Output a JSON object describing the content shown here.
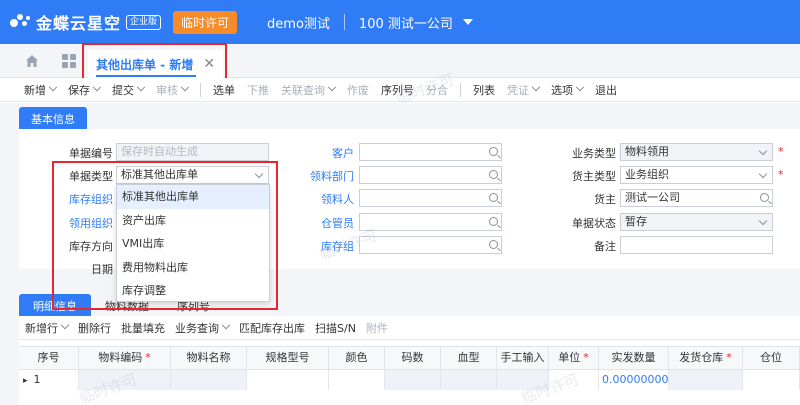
{
  "header": {
    "logo_text": "金蝶云星空",
    "edition_badge": "企业版",
    "license_button": "临时许可",
    "tenant": "demo测试",
    "org": "100  测试一公司"
  },
  "tabs": {
    "active_tab": "其他出库单 - 新增",
    "close_glyph": "✕"
  },
  "toolbar": {
    "items": [
      {
        "label": "新增",
        "dropdown": true,
        "disabled": false
      },
      {
        "label": "保存",
        "dropdown": true,
        "disabled": false
      },
      {
        "label": "提交",
        "dropdown": true,
        "disabled": false
      },
      {
        "label": "审核",
        "dropdown": true,
        "disabled": true
      },
      {
        "label": "选单",
        "dropdown": false,
        "disabled": false
      },
      {
        "label": "下推",
        "dropdown": false,
        "disabled": true
      },
      {
        "label": "关联查询",
        "dropdown": true,
        "disabled": true
      },
      {
        "label": "作废",
        "dropdown": false,
        "disabled": true
      },
      {
        "label": "序列号",
        "dropdown": false,
        "disabled": false
      },
      {
        "label": "分合",
        "dropdown": false,
        "disabled": true
      },
      {
        "label": "列表",
        "dropdown": false,
        "disabled": false
      },
      {
        "label": "凭证",
        "dropdown": true,
        "disabled": true
      },
      {
        "label": "选项",
        "dropdown": true,
        "disabled": false
      },
      {
        "label": "退出",
        "dropdown": false,
        "disabled": false
      }
    ]
  },
  "basic_info": {
    "section_title": "基本信息",
    "doc_no_label": "单据编号",
    "doc_no_placeholder": "保存时自动生成",
    "doc_type_label": "单据类型",
    "doc_type_value": "标准其他出库单",
    "stock_org_label": "库存组织",
    "pick_org_label": "领用组织",
    "stock_dir_label": "库存方向",
    "date_label": "日期",
    "customer_label": "客户",
    "pick_dept_label": "领料部门",
    "picker_label": "领料人",
    "keeper_label": "仓管员",
    "stock_group_label": "库存组",
    "biz_type_label": "业务类型",
    "biz_type_value": "物料领用",
    "owner_type_label": "货主类型",
    "owner_type_value": "业务组织",
    "owner_label": "货主",
    "owner_value": "测试一公司",
    "doc_status_label": "单据状态",
    "doc_status_value": "暂存",
    "remark_label": "备注",
    "required_mark": "*"
  },
  "dropdown": {
    "options": [
      "标准其他出库单",
      "资产出库",
      "VMI出库",
      "费用物料出库",
      "库存调整"
    ],
    "selected_index": 0
  },
  "detail": {
    "tabs": [
      "明细信息",
      "物料数据",
      "序列号"
    ],
    "toolbar": [
      {
        "label": "新增行",
        "dropdown": true,
        "disabled": false
      },
      {
        "label": "删除行",
        "dropdown": false,
        "disabled": false
      },
      {
        "label": "批量填充",
        "dropdown": false,
        "disabled": false
      },
      {
        "label": "业务查询",
        "dropdown": true,
        "disabled": false
      },
      {
        "label": "匹配库存出库",
        "dropdown": false,
        "disabled": false
      },
      {
        "label": "扫描S/N",
        "dropdown": false,
        "disabled": false
      },
      {
        "label": "附件",
        "dropdown": false,
        "disabled": true
      }
    ],
    "columns": [
      "序号",
      "物料编码",
      "物料名称",
      "规格型号",
      "颜色",
      "码数",
      "血型",
      "手工输入",
      "单位",
      "实发数量",
      "发货仓库",
      "仓位"
    ],
    "required_columns": [
      "物料编码",
      "单位",
      "发货仓库"
    ],
    "row": {
      "seq": "1",
      "qty": "0.0000000000"
    }
  },
  "watermark_text": "临时许可"
}
